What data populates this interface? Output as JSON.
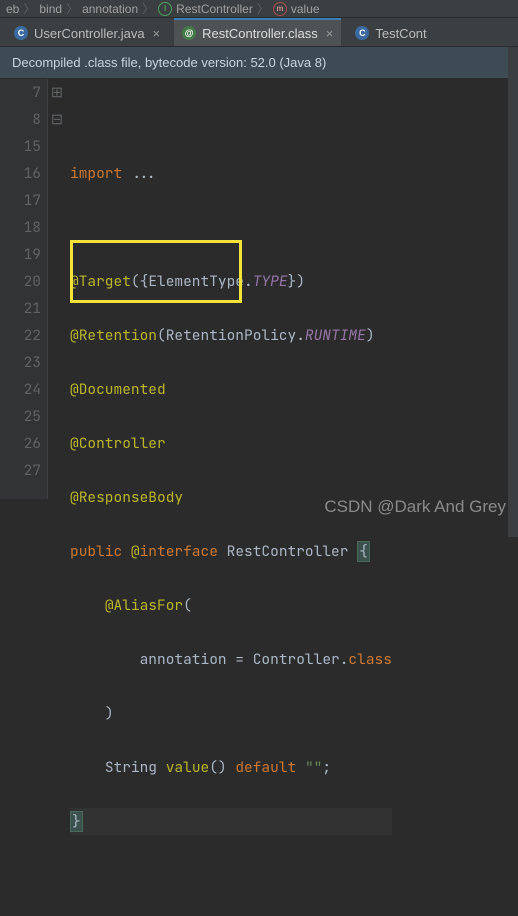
{
  "breadcrumb": {
    "items": [
      "eb",
      "bind",
      "annotation",
      "RestController",
      "value"
    ]
  },
  "tabs": [
    {
      "label": "UserController.java",
      "active": false
    },
    {
      "label": "RestController.class",
      "active": true
    },
    {
      "label": "TestCont",
      "active": false
    }
  ],
  "banner": "Decompiled .class file, bytecode version: 52.0 (Java 8)",
  "line_numbers": [
    "7",
    "8",
    "15",
    "16",
    "17",
    "18",
    "19",
    "20",
    "21",
    "22",
    "23",
    "24",
    "25",
    "26",
    "27",
    ""
  ],
  "fold_marks": [
    "",
    "⊞",
    "",
    "⊟",
    "",
    "",
    "",
    "",
    "",
    "",
    "",
    "",
    "",
    "",
    "",
    ""
  ],
  "code": {
    "import_kw": "import",
    "import_rest": " ",
    "ellipsis": "...",
    "l16_ann": "@Target",
    "l16_open": "({",
    "l16_et": "ElementType.",
    "l16_type": "TYPE",
    "l16_close": "})",
    "l17_ann": "@Retention",
    "l17_open": "(",
    "l17_rp": "RetentionPolicy.",
    "l17_runtime": "RUNTIME",
    "l17_close": ")",
    "l18_doc": "@Documented",
    "l19_ctrl": "@Controller",
    "l20_rb": "@ResponseBody",
    "l21_public": "public",
    "l21_sp1": " ",
    "l21_at": "@",
    "l21_interface": "interface",
    "l21_sp2": " ",
    "l21_name": "RestController ",
    "l21_brace": "{",
    "l22_alias": "@AliasFor",
    "l22_open": "(",
    "l23_annkey": "annotation = ",
    "l23_ctrl": "Controller",
    "l23_dot": ".",
    "l23_class": "class",
    "l24_close": ")",
    "l25_string": "String ",
    "l25_value": "value",
    "l25_par": "() ",
    "l25_default": "default",
    "l25_sp": " ",
    "l25_str": "\"\"",
    "l25_semi": ";",
    "l26_brace": "}"
  },
  "watermark": "CSDN @Dark And Grey"
}
